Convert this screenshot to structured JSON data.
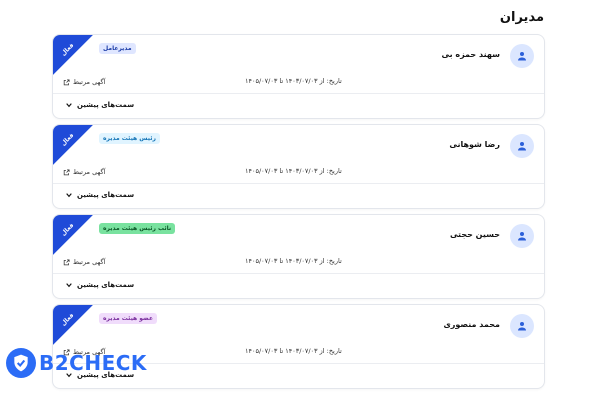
{
  "page_title": "مدیران",
  "status_colors": {
    "ribbon": "#1f4bd8"
  },
  "managers": [
    {
      "name": "سهند حمزه بی",
      "role": "مدیرعامل",
      "role_bg": "#dfe6ff",
      "role_fg": "#1f3fa8",
      "status": "فعال",
      "date_text": "تاریخ: از ۱۴۰۳/۰۷/۰۳ تا ۱۴۰۵/۰۷/۰۳",
      "link_label": "آگهی مرتبط",
      "prev_label": "سمت‌های پیشین"
    },
    {
      "name": "رضا شوهانی",
      "role": "رئیس هیئت مدیره",
      "role_bg": "#e0f4ff",
      "role_fg": "#1877b8",
      "status": "فعال",
      "date_text": "تاریخ: از ۱۴۰۳/۰۷/۰۳ تا ۱۴۰۵/۰۷/۰۳",
      "link_label": "آگهی مرتبط",
      "prev_label": "سمت‌های پیشین"
    },
    {
      "name": "حسین حجتی",
      "role": "نائب رئیس هیئت مدیره",
      "role_bg": "#79e29f",
      "role_fg": "#0d5a2a",
      "status": "فعال",
      "date_text": "تاریخ: از ۱۴۰۳/۰۷/۰۳ تا ۱۴۰۵/۰۷/۰۳",
      "link_label": "آگهی مرتبط",
      "prev_label": "سمت‌های پیشین"
    },
    {
      "name": "محمد منصوری",
      "role": "عضو هیئت مدیره",
      "role_bg": "#f0dcfb",
      "role_fg": "#7a2f9e",
      "status": "فعال",
      "date_text": "تاریخ: از ۱۴۰۳/۰۷/۰۳ تا ۱۴۰۵/۰۷/۰۳",
      "link_label": "آگهی مرتبط",
      "prev_label": "سمت‌های پیشین"
    }
  ],
  "watermark": {
    "text": "B2CHECK",
    "color": "#2b6cf6"
  }
}
